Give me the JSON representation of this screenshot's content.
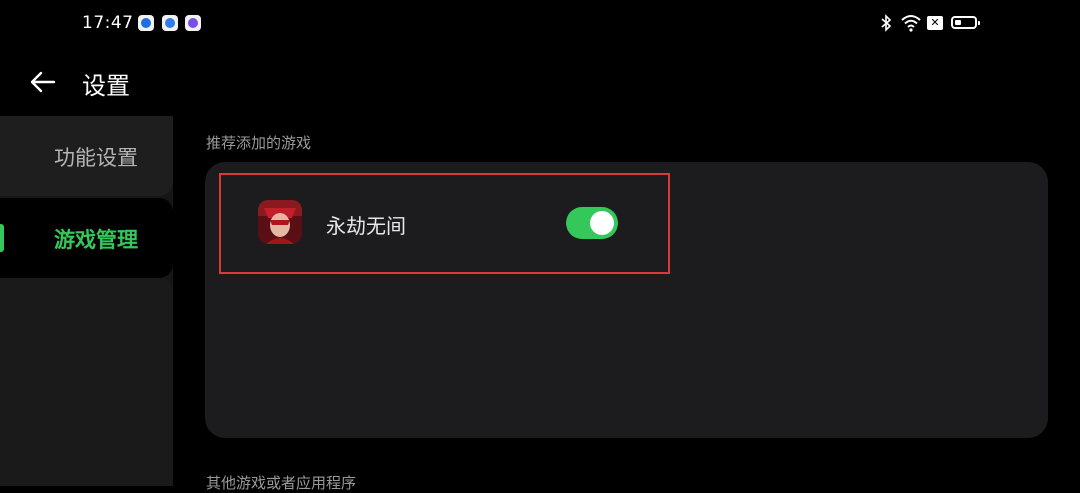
{
  "status_bar": {
    "time": "17:47",
    "left_apps": [
      {
        "icon": "app-icon-1",
        "color": "#1e6fe0"
      },
      {
        "icon": "app-icon-2",
        "color": "#2f7de8"
      },
      {
        "icon": "app-icon-3",
        "color": "#7a4de8"
      }
    ],
    "right_icons": [
      "bluetooth-icon",
      "wifi-icon",
      "no-sim-icon",
      "battery-icon"
    ],
    "no_sim_glyph": "✕",
    "battery_level": 0.35
  },
  "header": {
    "back_icon": "arrow-left-icon",
    "title": "设置"
  },
  "sidebar": {
    "items": [
      {
        "label": "功能设置",
        "selected": false
      },
      {
        "label": "游戏管理",
        "selected": true
      }
    ],
    "accent": "#34c759"
  },
  "main": {
    "recommended_title": "推荐添加的游戏",
    "games": [
      {
        "name": "永劫无间",
        "enabled": true
      }
    ],
    "other_title": "其他游戏或者应用程序"
  },
  "colors": {
    "background": "#000000",
    "card": "#1c1c1e",
    "toggle_on": "#34c759",
    "highlight_border": "#d83a3a"
  }
}
